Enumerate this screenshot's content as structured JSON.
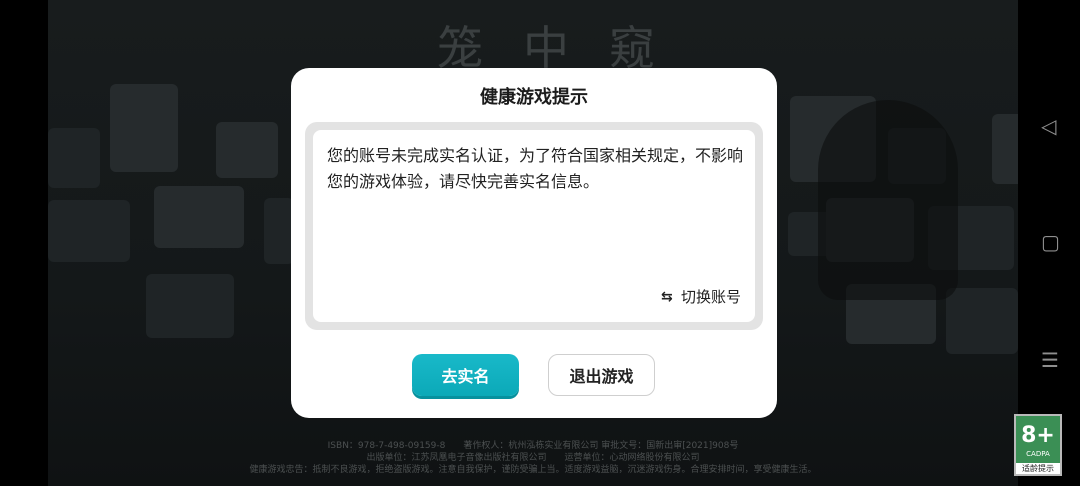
{
  "game": {
    "title": "笼中窥梦",
    "footer_line1": "ISBN：978-7-498-09159-8　　著作权人：杭州泓栋实业有限公司 审批文号：国新出审[2021]908号",
    "footer_line2": "出版单位：江苏凤凰电子音像出版社有限公司　　运营单位：心动网络股份有限公司",
    "footer_line3": "健康游戏忠告：抵制不良游戏，拒绝盗版游戏。注意自我保护，谨防受骗上当。适度游戏益脑，沉迷游戏伤身。合理安排时间，享受健康生活。"
  },
  "dialog": {
    "title": "健康游戏提示",
    "message": "您的账号未完成实名认证，为了符合国家相关规定，不影响您的游戏体验，请尽快完善实名信息。",
    "switch_icon": "⇆",
    "switch_label": "切换账号",
    "verify_label": "去实名",
    "exit_label": "退出游戏"
  },
  "age_rating": {
    "value": "8+",
    "org": "CADPA",
    "label": "适龄提示",
    "color": "#3b8f55"
  },
  "nav": {
    "back_icon": "◁",
    "home_icon": "▢",
    "menu_icon": "☰"
  }
}
